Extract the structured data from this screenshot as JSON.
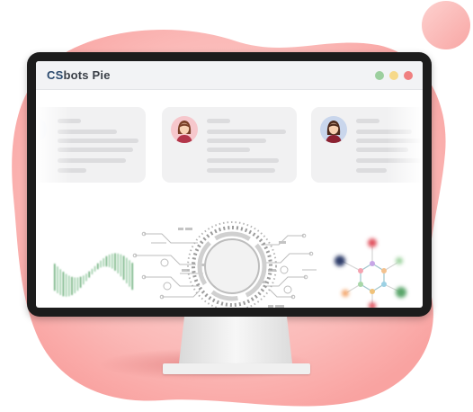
{
  "app": {
    "title_brand": "CS",
    "title_rest": "bots Pie"
  },
  "window_controls": [
    {
      "name": "maximize",
      "color": "#9ccf9e"
    },
    {
      "name": "minimize",
      "color": "#f6d98a"
    },
    {
      "name": "close",
      "color": "#f08080"
    }
  ],
  "colors": {
    "blob": "#fbb9b7",
    "blob_dark": "#f79f9d",
    "monitor_frame": "#1c1c1c",
    "accent_green": "#5aa56a",
    "accent_navy": "#2e3d6b",
    "accent_red": "#e0525f",
    "accent_orange": "#f3a56b"
  },
  "cards": [
    {
      "avatar": "avatar-partial"
    },
    {
      "avatar": "woman-avatar"
    },
    {
      "avatar": "woman-avatar"
    }
  ],
  "icons": [
    "ring-gauge-icon",
    "wave-bars-icon",
    "molecule-network-icon",
    "circuit-lines-icon"
  ]
}
